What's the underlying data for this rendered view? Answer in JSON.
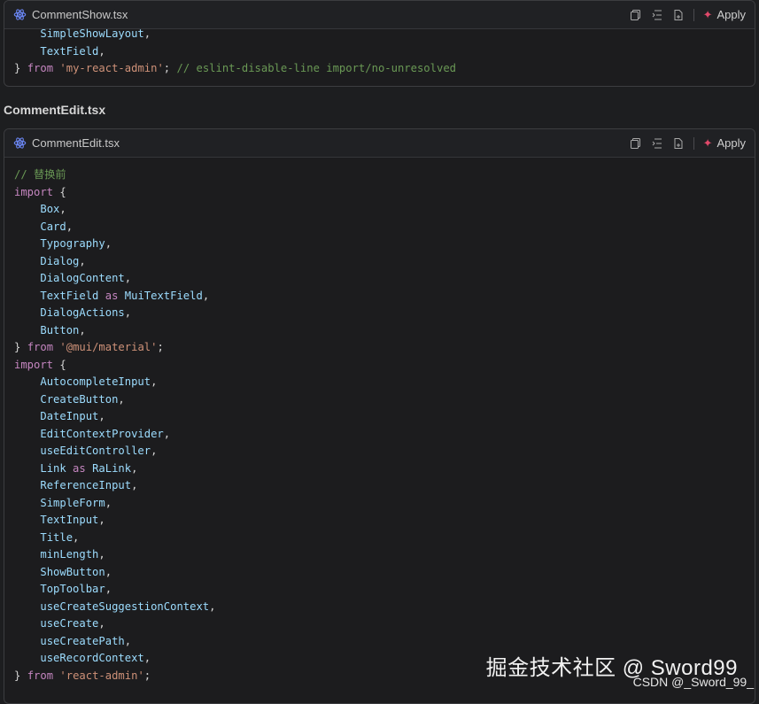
{
  "block1": {
    "filename": "CommentShow.tsx",
    "apply_label": "Apply",
    "lines": [
      {
        "indent": "    ",
        "parts": [
          {
            "t": "SimpleShowLayout",
            "c": "id"
          },
          {
            "t": ",",
            "c": ""
          }
        ]
      },
      {
        "indent": "    ",
        "parts": [
          {
            "t": "TextField",
            "c": "id"
          },
          {
            "t": ",",
            "c": ""
          }
        ]
      },
      {
        "indent": "",
        "parts": [
          {
            "t": "} ",
            "c": ""
          },
          {
            "t": "from",
            "c": "kw"
          },
          {
            "t": " ",
            "c": ""
          },
          {
            "t": "'my-react-admin'",
            "c": "str"
          },
          {
            "t": "; ",
            "c": ""
          },
          {
            "t": "// eslint-disable-line import/no-unresolved",
            "c": "cm"
          }
        ]
      }
    ]
  },
  "section_title": "CommentEdit.tsx",
  "block2": {
    "filename": "CommentEdit.tsx",
    "apply_label": "Apply",
    "lines": [
      {
        "indent": "",
        "parts": [
          {
            "t": "// 替换前",
            "c": "cm"
          }
        ]
      },
      {
        "indent": "",
        "parts": [
          {
            "t": "import",
            "c": "kw"
          },
          {
            "t": " {",
            "c": ""
          }
        ]
      },
      {
        "indent": "    ",
        "parts": [
          {
            "t": "Box",
            "c": "id"
          },
          {
            "t": ",",
            "c": ""
          }
        ]
      },
      {
        "indent": "    ",
        "parts": [
          {
            "t": "Card",
            "c": "id"
          },
          {
            "t": ",",
            "c": ""
          }
        ]
      },
      {
        "indent": "    ",
        "parts": [
          {
            "t": "Typography",
            "c": "id"
          },
          {
            "t": ",",
            "c": ""
          }
        ]
      },
      {
        "indent": "    ",
        "parts": [
          {
            "t": "Dialog",
            "c": "id"
          },
          {
            "t": ",",
            "c": ""
          }
        ]
      },
      {
        "indent": "    ",
        "parts": [
          {
            "t": "DialogContent",
            "c": "id"
          },
          {
            "t": ",",
            "c": ""
          }
        ]
      },
      {
        "indent": "    ",
        "parts": [
          {
            "t": "TextField",
            "c": "id"
          },
          {
            "t": " as ",
            "c": "kw"
          },
          {
            "t": "MuiTextField",
            "c": "id"
          },
          {
            "t": ",",
            "c": ""
          }
        ]
      },
      {
        "indent": "    ",
        "parts": [
          {
            "t": "DialogActions",
            "c": "id"
          },
          {
            "t": ",",
            "c": ""
          }
        ]
      },
      {
        "indent": "    ",
        "parts": [
          {
            "t": "Button",
            "c": "id"
          },
          {
            "t": ",",
            "c": ""
          }
        ]
      },
      {
        "indent": "",
        "parts": [
          {
            "t": "} ",
            "c": ""
          },
          {
            "t": "from",
            "c": "kw"
          },
          {
            "t": " ",
            "c": ""
          },
          {
            "t": "'@mui/material'",
            "c": "str"
          },
          {
            "t": ";",
            "c": ""
          }
        ]
      },
      {
        "indent": "",
        "parts": [
          {
            "t": "import",
            "c": "kw"
          },
          {
            "t": " {",
            "c": ""
          }
        ]
      },
      {
        "indent": "    ",
        "parts": [
          {
            "t": "AutocompleteInput",
            "c": "id"
          },
          {
            "t": ",",
            "c": ""
          }
        ]
      },
      {
        "indent": "    ",
        "parts": [
          {
            "t": "CreateButton",
            "c": "id"
          },
          {
            "t": ",",
            "c": ""
          }
        ]
      },
      {
        "indent": "    ",
        "parts": [
          {
            "t": "DateInput",
            "c": "id"
          },
          {
            "t": ",",
            "c": ""
          }
        ]
      },
      {
        "indent": "    ",
        "parts": [
          {
            "t": "EditContextProvider",
            "c": "id"
          },
          {
            "t": ",",
            "c": ""
          }
        ]
      },
      {
        "indent": "    ",
        "parts": [
          {
            "t": "useEditController",
            "c": "id"
          },
          {
            "t": ",",
            "c": ""
          }
        ]
      },
      {
        "indent": "    ",
        "parts": [
          {
            "t": "Link",
            "c": "id"
          },
          {
            "t": " as ",
            "c": "kw"
          },
          {
            "t": "RaLink",
            "c": "id"
          },
          {
            "t": ",",
            "c": ""
          }
        ]
      },
      {
        "indent": "    ",
        "parts": [
          {
            "t": "ReferenceInput",
            "c": "id"
          },
          {
            "t": ",",
            "c": ""
          }
        ]
      },
      {
        "indent": "    ",
        "parts": [
          {
            "t": "SimpleForm",
            "c": "id"
          },
          {
            "t": ",",
            "c": ""
          }
        ]
      },
      {
        "indent": "    ",
        "parts": [
          {
            "t": "TextInput",
            "c": "id"
          },
          {
            "t": ",",
            "c": ""
          }
        ]
      },
      {
        "indent": "    ",
        "parts": [
          {
            "t": "Title",
            "c": "id"
          },
          {
            "t": ",",
            "c": ""
          }
        ]
      },
      {
        "indent": "    ",
        "parts": [
          {
            "t": "minLength",
            "c": "id"
          },
          {
            "t": ",",
            "c": ""
          }
        ]
      },
      {
        "indent": "    ",
        "parts": [
          {
            "t": "ShowButton",
            "c": "id"
          },
          {
            "t": ",",
            "c": ""
          }
        ]
      },
      {
        "indent": "    ",
        "parts": [
          {
            "t": "TopToolbar",
            "c": "id"
          },
          {
            "t": ",",
            "c": ""
          }
        ]
      },
      {
        "indent": "    ",
        "parts": [
          {
            "t": "useCreateSuggestionContext",
            "c": "id"
          },
          {
            "t": ",",
            "c": ""
          }
        ]
      },
      {
        "indent": "    ",
        "parts": [
          {
            "t": "useCreate",
            "c": "id"
          },
          {
            "t": ",",
            "c": ""
          }
        ]
      },
      {
        "indent": "    ",
        "parts": [
          {
            "t": "useCreatePath",
            "c": "id"
          },
          {
            "t": ",",
            "c": ""
          }
        ]
      },
      {
        "indent": "    ",
        "parts": [
          {
            "t": "useRecordContext",
            "c": "id"
          },
          {
            "t": ",",
            "c": ""
          }
        ]
      },
      {
        "indent": "",
        "parts": [
          {
            "t": "} ",
            "c": ""
          },
          {
            "t": "from",
            "c": "kw"
          },
          {
            "t": " ",
            "c": ""
          },
          {
            "t": "'react-admin'",
            "c": "str"
          },
          {
            "t": ";",
            "c": ""
          }
        ]
      }
    ]
  },
  "watermark": "掘金技术社区 @ Sword99",
  "watermark_sub": "CSDN @_Sword_99_",
  "icons": [
    "react-icon",
    "copy-icon",
    "insert-icon",
    "new-file-icon",
    "apply-sparkle-icon"
  ]
}
